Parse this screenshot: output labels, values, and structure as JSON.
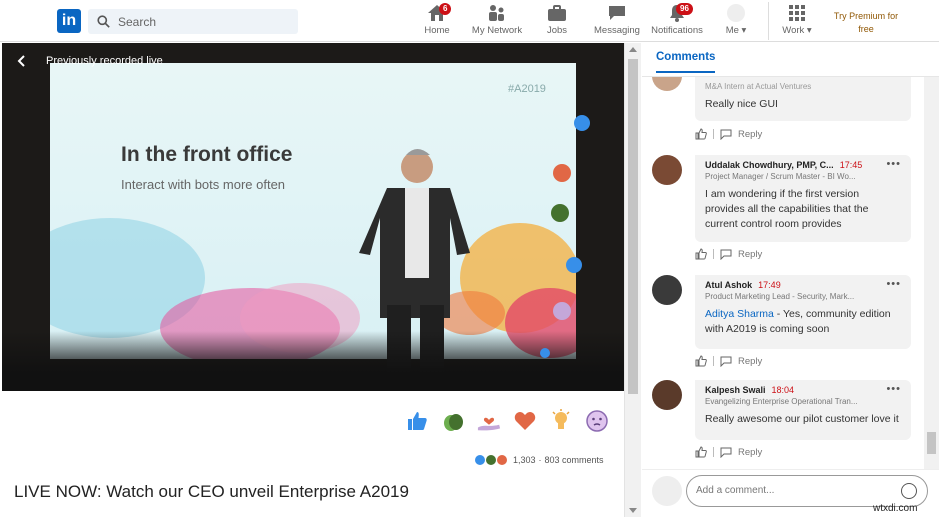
{
  "nav": {
    "search_placeholder": "Search",
    "items": [
      {
        "label": "Home",
        "icon": "home-icon",
        "badge": "6"
      },
      {
        "label": "My Network",
        "icon": "network-icon",
        "badge": ""
      },
      {
        "label": "Jobs",
        "icon": "briefcase-icon",
        "badge": ""
      },
      {
        "label": "Messaging",
        "icon": "message-icon",
        "badge": ""
      },
      {
        "label": "Notifications",
        "icon": "bell-icon",
        "badge": "96"
      },
      {
        "label": "Me",
        "icon": "avatar-icon",
        "badge": ""
      },
      {
        "label": "Work",
        "icon": "grid-icon",
        "badge": ""
      }
    ],
    "premium": "Try Premium for free",
    "logo_text": "in"
  },
  "video": {
    "header_text": "Previously recorded live",
    "slide_tag": "#A2019",
    "slide_title": "In the front office",
    "slide_subtitle": "Interact with bots more often",
    "reaction_count": "1,303",
    "comment_count": "803 comments",
    "title": "LIVE NOW: Watch our CEO unveil Enterprise A2019"
  },
  "comments_panel": {
    "tab": "Comments",
    "input_placeholder": "Add a comment...",
    "reply_label": "Reply",
    "comments": [
      {
        "name": "",
        "time": "",
        "role": "M&A Intern at Actual Ventures",
        "text": "Really nice GUI",
        "mention": ""
      },
      {
        "name": "Uddalak Chowdhury, PMP, C...",
        "time": "17:45",
        "role": "Project Manager / Scrum Master - BI Wo...",
        "text": "I am wondering if the first version provides all the capabilities that the current control room provides",
        "mention": ""
      },
      {
        "name": "Atul Ashok",
        "time": "17:49",
        "role": "Product Marketing Lead - Security, Mark...",
        "text": " - Yes, community edition with A2019 is coming soon",
        "mention": "Aditya Sharma"
      },
      {
        "name": "Kalpesh Swali",
        "time": "18:04",
        "role": "Evangelizing Enterprise Operational Tran...",
        "text": "Really awesome our pilot customer love it",
        "mention": ""
      }
    ]
  },
  "watermark": "wtxdi.com",
  "colors": {
    "brand": "#0a66c2",
    "badge": "#cc1016"
  }
}
